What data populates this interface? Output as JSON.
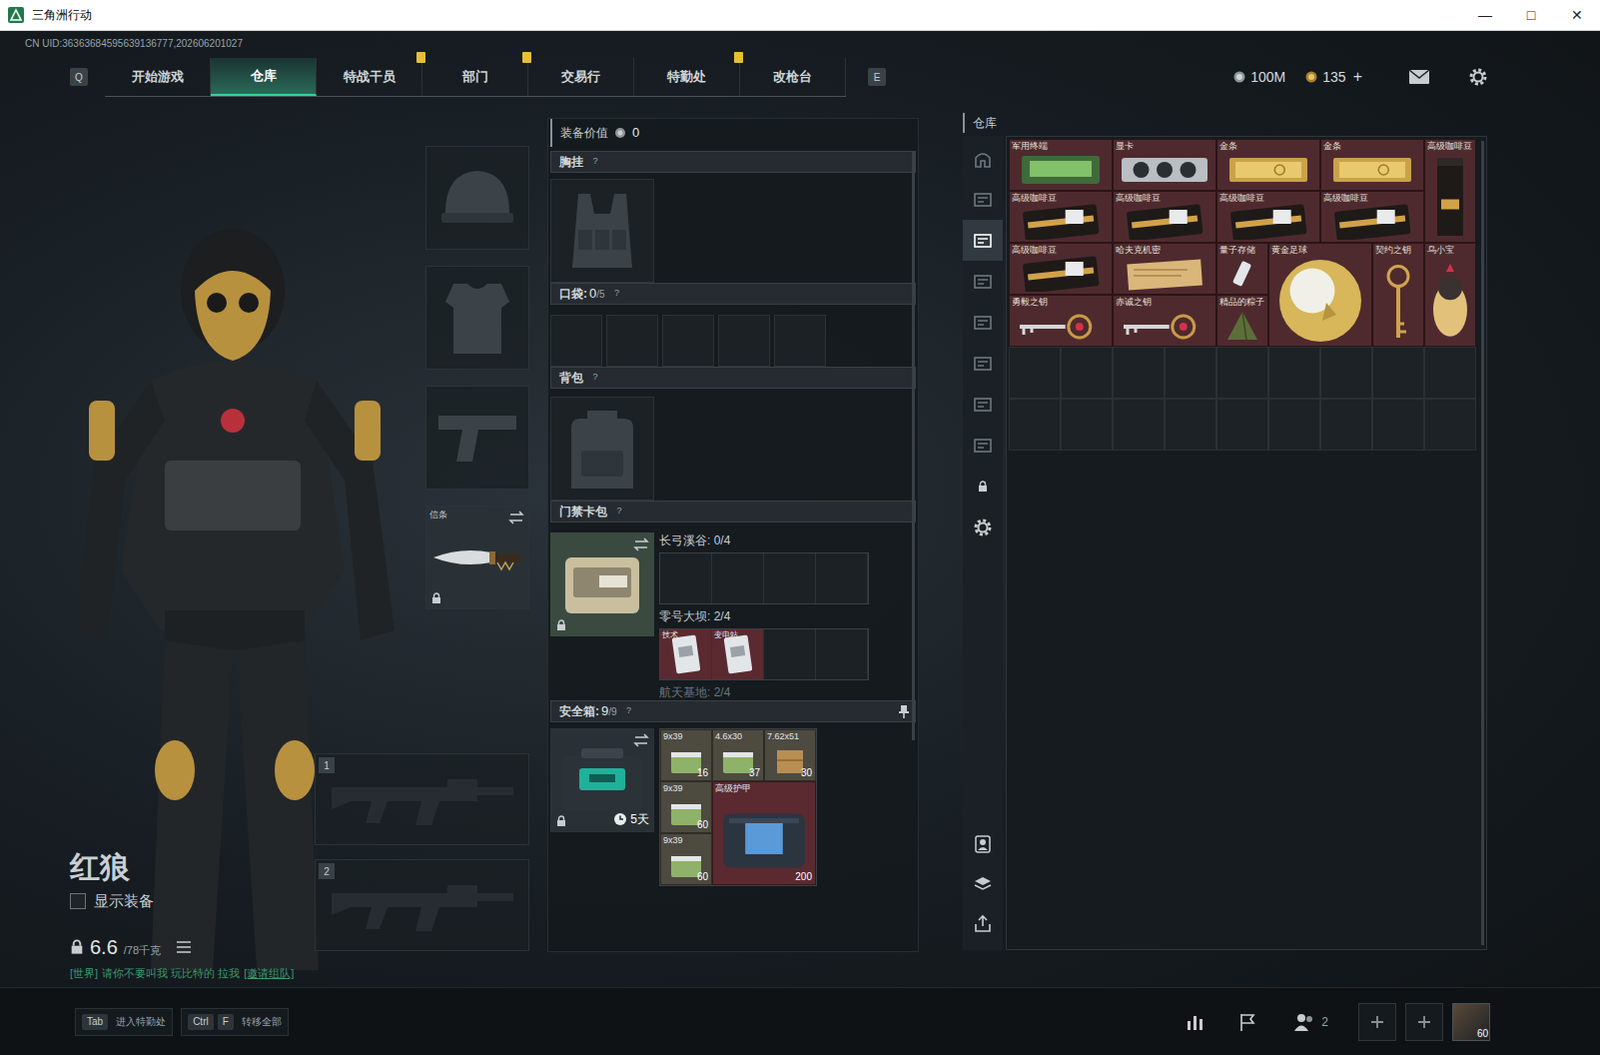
{
  "window": {
    "title": "三角洲行动",
    "controls": [
      "—",
      "□",
      "✕"
    ]
  },
  "uid": "CN UID:36363684595639136777,202606201027",
  "nav": {
    "prev_key": "Q",
    "next_key": "E",
    "tabs": [
      {
        "label": "开始游戏",
        "selected": false,
        "alert": false
      },
      {
        "label": "仓库",
        "selected": true,
        "alert": false
      },
      {
        "label": "特战干员",
        "selected": false,
        "alert": true
      },
      {
        "label": "部门",
        "selected": false,
        "alert": true
      },
      {
        "label": "交易行",
        "selected": false,
        "alert": false
      },
      {
        "label": "特勤处",
        "selected": false,
        "alert": true
      },
      {
        "label": "改枪台",
        "selected": false,
        "alert": false
      }
    ]
  },
  "currencies": [
    {
      "amount": "100M",
      "kind": "silver"
    },
    {
      "amount": "135",
      "kind": "gold",
      "action": "+"
    }
  ],
  "character": {
    "name": "红狼",
    "show_equipment": {
      "label": "显示装备",
      "checked": false
    },
    "weight": "6.6",
    "capacity": "/78千克"
  },
  "chat": {
    "channel": "[世界]",
    "message": "请你不要叫我 玩比特的 拉我",
    "action": "[邀请组队]"
  },
  "gear_slots": [
    {
      "kind": "helmet",
      "filled": false
    },
    {
      "kind": "armor",
      "filled": false
    },
    {
      "kind": "pistol",
      "filled": false
    },
    {
      "kind": "melee",
      "filled": true,
      "label": "信条",
      "locked": true
    }
  ],
  "weapon_slots": [
    {
      "number": "1",
      "filled": false
    },
    {
      "number": "2",
      "filled": false
    }
  ],
  "loadout": {
    "value_label": "装备价值",
    "value": "0",
    "chest_rig": {
      "title": "胸挂",
      "help": "?"
    },
    "pockets": {
      "title": "口袋:",
      "count": "0",
      "capacity": "/5",
      "help": "?"
    },
    "backpack": {
      "title": "背包",
      "help": "?"
    },
    "keycard": {
      "title": "门禁卡包",
      "help": "?",
      "locked": true,
      "maps": [
        {
          "name": "长弓溪谷: 0/4",
          "cards": []
        },
        {
          "name": "零号大坝: 2/4",
          "cards": [
            {
              "label": "技术"
            },
            {
              "label": "变电站"
            }
          ]
        },
        {
          "name": "航天基地: 2/4",
          "cards": []
        }
      ]
    },
    "safe_box": {
      "title": "安全箱:",
      "count": "9",
      "capacity": "/9",
      "help": "?",
      "timer": "5天",
      "locked": true,
      "items": [
        {
          "label": "9x39",
          "count": "16",
          "kind": "ammo",
          "w": 1,
          "h": 1,
          "color": "#4d4a40"
        },
        {
          "label": "4.6x30",
          "count": "37",
          "kind": "ammo",
          "w": 1,
          "h": 1,
          "color": "#4d4a40"
        },
        {
          "label": "7.62x51",
          "count": "30",
          "kind": "crate",
          "w": 1,
          "h": 1,
          "color": "#4d4a40"
        },
        {
          "label": "9x39",
          "count": "60",
          "kind": "ammo",
          "w": 1,
          "h": 1,
          "color": "#4d4a40"
        },
        {
          "label": "高级护甲",
          "count": "200",
          "kind": "armor",
          "w": 2,
          "h": 2,
          "color": "#5a2a30"
        },
        {
          "label": "9x39",
          "count": "60",
          "kind": "ammo",
          "w": 1,
          "h": 1,
          "color": "#4d4a40"
        }
      ]
    }
  },
  "warehouse": {
    "title": "仓库",
    "sidebar": [
      {
        "kind": "home",
        "selected": false
      },
      {
        "kind": "tab",
        "selected": false
      },
      {
        "kind": "tab",
        "selected": true
      },
      {
        "kind": "tab",
        "selected": false
      },
      {
        "kind": "tab",
        "selected": false
      },
      {
        "kind": "tab",
        "selected": false
      },
      {
        "kind": "tab",
        "selected": false
      },
      {
        "kind": "tab",
        "selected": false
      },
      {
        "kind": "lock",
        "selected": false
      },
      {
        "kind": "gear",
        "selected": false
      }
    ],
    "sidebar_bottom": [
      {
        "kind": "person"
      },
      {
        "kind": "layers"
      },
      {
        "kind": "transfer"
      }
    ],
    "items": [
      {
        "label": "军用终端",
        "kind": "terminal",
        "w": 2,
        "h": 1,
        "color": "#4e2a2e"
      },
      {
        "label": "显卡",
        "kind": "gpu",
        "w": 2,
        "h": 1,
        "color": "#4e2a2e"
      },
      {
        "label": "金条",
        "kind": "gold",
        "w": 2,
        "h": 1,
        "color": "#4e2a2e"
      },
      {
        "label": "金条",
        "kind": "gold",
        "w": 2,
        "h": 1,
        "color": "#4e2a2e"
      },
      {
        "label": "高级咖啡豆",
        "kind": "coffee_bag",
        "w": 1,
        "h": 2,
        "color": "#4e2a2e"
      },
      {
        "label": "高级咖啡豆",
        "kind": "coffee",
        "w": 2,
        "h": 1,
        "color": "#4e2a2e"
      },
      {
        "label": "高级咖啡豆",
        "kind": "coffee",
        "w": 2,
        "h": 1,
        "color": "#4e2a2e"
      },
      {
        "label": "高级咖啡豆",
        "kind": "coffee",
        "w": 2,
        "h": 1,
        "color": "#4e2a2e"
      },
      {
        "label": "高级咖啡豆",
        "kind": "coffee",
        "w": 2,
        "h": 1,
        "color": "#4e2a2e"
      },
      {
        "label": "高级咖啡豆",
        "kind": "coffee",
        "w": 2,
        "h": 1,
        "color": "#4e2a2e"
      },
      {
        "label": "哈夫克机密",
        "kind": "document",
        "w": 2,
        "h": 1,
        "color": "#4e2a2e"
      },
      {
        "label": "量子存储",
        "kind": "usb",
        "w": 1,
        "h": 1,
        "color": "#4e2a2e"
      },
      {
        "label": "黄金足球",
        "kind": "ball",
        "w": 2,
        "h": 2,
        "color": "#4e2a2e"
      },
      {
        "label": "契约之钥",
        "kind": "key_tall",
        "w": 1,
        "h": 2,
        "color": "#4e2a2e"
      },
      {
        "label": "乌小宝",
        "kind": "egg",
        "w": 1,
        "h": 2,
        "color": "#4e2a2e"
      },
      {
        "label": "勇毅之钥",
        "kind": "key",
        "w": 2,
        "h": 1,
        "color": "#4e2a2e"
      },
      {
        "label": "赤诚之钥",
        "kind": "key",
        "w": 2,
        "h": 1,
        "color": "#4e2a2e"
      },
      {
        "label": "精品的粽子",
        "kind": "zongzi",
        "w": 1,
        "h": 1,
        "color": "#4e2a2e"
      }
    ]
  },
  "bottom": {
    "hints": [
      {
        "keys": [
          "Tab"
        ],
        "label": "进入特勤处"
      },
      {
        "keys": [
          "Ctrl",
          "F"
        ],
        "label": "转移全部"
      }
    ],
    "friends": "2",
    "level": "60"
  }
}
